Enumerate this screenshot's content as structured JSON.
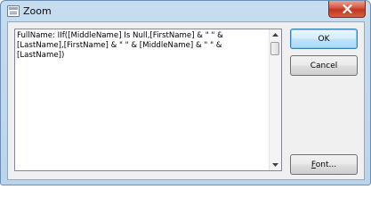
{
  "window": {
    "title": "Zoom"
  },
  "editor": {
    "text": "FullName: IIf([MiddleName] Is Null,[FirstName] & \" \" & [LastName],[FirstName] & \" \" & [MiddleName] & \" \" & [LastName])"
  },
  "buttons": {
    "ok": "OK",
    "cancel": "Cancel",
    "font_underlined": "F",
    "font_rest": "ont..."
  },
  "icons": {
    "app": "zoom-window-icon",
    "close": "close-icon",
    "scroll_up": "scroll-up-arrow-icon",
    "scroll_down": "scroll-down-arrow-icon"
  }
}
